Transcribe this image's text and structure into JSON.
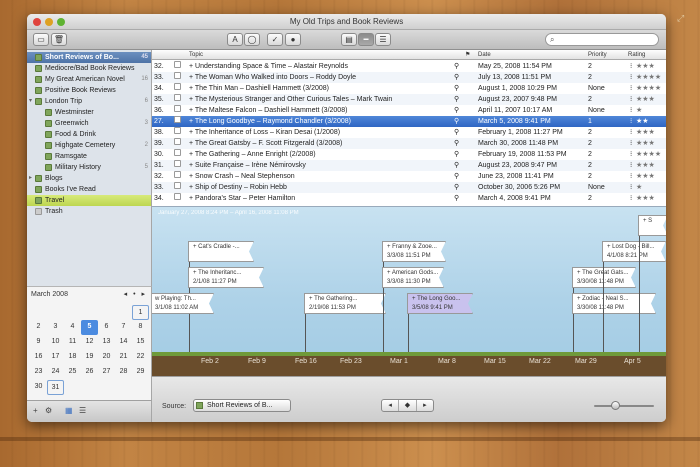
{
  "window": {
    "title": "My Old Trips and Book Reviews"
  },
  "toolbar": {
    "buttons": [
      {
        "name": "new-document-button",
        "icon": "document-icon",
        "glyph": "▭"
      },
      {
        "name": "delete-button",
        "icon": "trash-icon",
        "glyph": "🗑"
      },
      {
        "name": "font-button",
        "icon": "font-icon",
        "glyph": "A"
      },
      {
        "name": "color-button",
        "icon": "color-wheel-icon",
        "glyph": "◯"
      },
      {
        "name": "checkmark-button",
        "icon": "checkmark-icon",
        "glyph": "✓"
      },
      {
        "name": "record-button",
        "icon": "record-icon",
        "glyph": "●"
      },
      {
        "name": "view-outline-button",
        "icon": "outline-view-icon",
        "glyph": "▤"
      },
      {
        "name": "view-timeline-button",
        "icon": "timeline-view-icon",
        "glyph": "━"
      },
      {
        "name": "view-list-button",
        "icon": "list-view-icon",
        "glyph": "☰"
      }
    ],
    "search": {
      "icon": "search-icon",
      "glyph": "⌕",
      "placeholder": ""
    }
  },
  "sidebar": {
    "items": [
      {
        "label": "Short Reviews of Bo...",
        "count": "45",
        "indent": 0,
        "state": "sel",
        "disclosure": ""
      },
      {
        "label": "Mediocre/Bad Book Reviews",
        "count": "",
        "indent": 0,
        "state": "",
        "disclosure": ""
      },
      {
        "label": "My Great American Novel",
        "count": "16",
        "indent": 0,
        "state": "",
        "disclosure": ""
      },
      {
        "label": "Positive Book Reviews",
        "count": "",
        "indent": 0,
        "state": "",
        "disclosure": ""
      },
      {
        "label": "London Trip",
        "count": "6",
        "indent": 0,
        "state": "",
        "disclosure": "▾"
      },
      {
        "label": "Westminster",
        "count": "",
        "indent": 1,
        "state": "",
        "disclosure": ""
      },
      {
        "label": "Greenwich",
        "count": "3",
        "indent": 1,
        "state": "",
        "disclosure": ""
      },
      {
        "label": "Food & Drink",
        "count": "",
        "indent": 1,
        "state": "",
        "disclosure": ""
      },
      {
        "label": "Highgate Cemetery",
        "count": "2",
        "indent": 1,
        "state": "",
        "disclosure": ""
      },
      {
        "label": "Ramsgate",
        "count": "",
        "indent": 1,
        "state": "",
        "disclosure": ""
      },
      {
        "label": "Military History",
        "count": "5",
        "indent": 1,
        "state": "",
        "disclosure": ""
      },
      {
        "label": "Blogs",
        "count": "",
        "indent": 0,
        "state": "",
        "disclosure": "▸"
      },
      {
        "label": "Books I've Read",
        "count": "",
        "indent": 0,
        "state": "",
        "disclosure": ""
      },
      {
        "label": "Travel",
        "count": "",
        "indent": 0,
        "state": "hl",
        "disclosure": ""
      },
      {
        "label": "Trash",
        "count": "",
        "indent": 0,
        "state": "",
        "disclosure": ""
      }
    ]
  },
  "calendar": {
    "month": "March 2008",
    "nav": "◂ • ▸",
    "weeks": [
      [
        {
          "d": "",
          "c": ""
        },
        {
          "d": "",
          "c": ""
        },
        {
          "d": "",
          "c": ""
        },
        {
          "d": "",
          "c": ""
        },
        {
          "d": "",
          "c": ""
        },
        {
          "d": "",
          "c": ""
        },
        {
          "d": "1",
          "c": "o"
        }
      ],
      [
        {
          "d": "2",
          "c": ""
        },
        {
          "d": "3",
          "c": ""
        },
        {
          "d": "4",
          "c": ""
        },
        {
          "d": "5",
          "c": "t"
        },
        {
          "d": "6",
          "c": ""
        },
        {
          "d": "7",
          "c": ""
        },
        {
          "d": "8",
          "c": ""
        }
      ],
      [
        {
          "d": "9",
          "c": ""
        },
        {
          "d": "10",
          "c": ""
        },
        {
          "d": "11",
          "c": ""
        },
        {
          "d": "12",
          "c": ""
        },
        {
          "d": "13",
          "c": ""
        },
        {
          "d": "14",
          "c": ""
        },
        {
          "d": "15",
          "c": ""
        }
      ],
      [
        {
          "d": "16",
          "c": ""
        },
        {
          "d": "17",
          "c": ""
        },
        {
          "d": "18",
          "c": ""
        },
        {
          "d": "19",
          "c": ""
        },
        {
          "d": "20",
          "c": ""
        },
        {
          "d": "21",
          "c": ""
        },
        {
          "d": "22",
          "c": ""
        }
      ],
      [
        {
          "d": "23",
          "c": ""
        },
        {
          "d": "24",
          "c": ""
        },
        {
          "d": "25",
          "c": ""
        },
        {
          "d": "26",
          "c": ""
        },
        {
          "d": "27",
          "c": ""
        },
        {
          "d": "28",
          "c": ""
        },
        {
          "d": "29",
          "c": ""
        }
      ],
      [
        {
          "d": "30",
          "c": ""
        },
        {
          "d": "31",
          "c": "o"
        },
        {
          "d": "",
          "c": ""
        },
        {
          "d": "",
          "c": ""
        },
        {
          "d": "",
          "c": ""
        },
        {
          "d": "",
          "c": ""
        },
        {
          "d": "",
          "c": ""
        }
      ]
    ]
  },
  "sidebar_footer": {
    "add": "+",
    "gear": "⚙",
    "view": "▦",
    "list": "☰"
  },
  "table": {
    "columns": {
      "topic": "Topic",
      "date": "Date",
      "priority": "Priority",
      "rating": "Rating"
    },
    "rows": [
      {
        "num": "32.",
        "topic": "+ Understanding Space & Time – Alastair Reynolds",
        "date": "May 25, 2008 11:54 PM",
        "priority": "2",
        "rating": "★★★"
      },
      {
        "num": "33.",
        "topic": "+ The Woman Who Walked into Doors – Roddy Doyle",
        "date": "July 13, 2008 11:51 PM",
        "priority": "2",
        "rating": "★★★★"
      },
      {
        "num": "34.",
        "topic": "+ The Thin Man – Dashiell Hammett (3/2008)",
        "date": "August 1, 2008 10:29 PM",
        "priority": "None",
        "rating": "★★★★"
      },
      {
        "num": "35.",
        "topic": "+ The Mysterious Stranger and Other Curious Tales – Mark Twain",
        "date": "August 23, 2007 9:48 PM",
        "priority": "2",
        "rating": "★★★"
      },
      {
        "num": "36.",
        "topic": "+ The Maltese Falcon – Dashiell Hammett (3/2008)",
        "date": "April 11, 2007 10:17 AM",
        "priority": "None",
        "rating": "★"
      },
      {
        "num": "27.",
        "topic": "+ The Long Goodbye – Raymond Chandler (3/2008)",
        "date": "March 5, 2008 9:41 PM",
        "priority": "1",
        "rating": "★★"
      },
      {
        "num": "38.",
        "topic": "+ The Inheritance of Loss – Kiran Desai (1/2008)",
        "date": "February 1, 2008 11:27 PM",
        "priority": "2",
        "rating": "★★★"
      },
      {
        "num": "39.",
        "topic": "+ The Great Gatsby – F. Scott Fitzgerald (3/2008)",
        "date": "March 30, 2008 11:48 PM",
        "priority": "2",
        "rating": "★★★"
      },
      {
        "num": "30.",
        "topic": "+ The Gathering – Anne Enright (2/2008)",
        "date": "February 19, 2008 11:53 PM",
        "priority": "2",
        "rating": "★★★★"
      },
      {
        "num": "31.",
        "topic": "+ Suite Française – Irène Némirovsky",
        "date": "August 23, 2008 9:47 PM",
        "priority": "2",
        "rating": "★★★"
      },
      {
        "num": "32.",
        "topic": "+ Snow Crash – Neal Stephenson",
        "date": "June 23, 2008 11:41 PM",
        "priority": "2",
        "rating": "★★★"
      },
      {
        "num": "33.",
        "topic": "+ Ship of Destiny – Robin Hebb",
        "date": "October 30, 2006 5:26 PM",
        "priority": "None",
        "rating": "★"
      },
      {
        "num": "34.",
        "topic": "+ Pandora's Star – Peter Hamilton",
        "date": "March 4, 2008 9:41 PM",
        "priority": "2",
        "rating": "★★★"
      }
    ],
    "selected_index": 5
  },
  "timeline": {
    "range": "January 27, 2008 8:24 PM – April 16, 2008 11:08 PM",
    "ticks": [
      "Feb 2",
      "Feb 9",
      "Feb 16",
      "Feb 23",
      "Mar 1",
      "Mar 8",
      "Mar 15",
      "Mar 22",
      "Mar 29",
      "Apr 5"
    ],
    "flags": [
      {
        "line1": "+ Cat's Cradle -...",
        "line2": "",
        "sel": false
      },
      {
        "line1": "+ The Inheritanc...",
        "line2": "2/1/08 11:27 PM",
        "sel": false
      },
      {
        "line1": "w Playing: Th...",
        "line2": "3/1/08 11:02 AM",
        "sel": false
      },
      {
        "line1": "+ The Gathering...",
        "line2": "2/19/08 11:53 PM",
        "sel": false
      },
      {
        "line1": "+ Franny & Zooe...",
        "line2": "3/3/08 11:51 PM",
        "sel": false
      },
      {
        "line1": "+ American Gods...",
        "line2": "3/3/08 11:30 PM",
        "sel": false
      },
      {
        "line1": "+ The Long Goo...",
        "line2": "3/5/08 9:41 PM",
        "sel": true
      },
      {
        "line1": "+ The Great Gats...",
        "line2": "3/30/08 11:48 PM",
        "sel": false
      },
      {
        "line1": "+ Zodiac - Neal S...",
        "line2": "3/30/08 11:48 PM",
        "sel": false
      },
      {
        "line1": "+ Lost Dog - Bill...",
        "line2": "4/1/08 8:21 PM",
        "sel": false
      },
      {
        "line1": "+ S",
        "line2": "",
        "sel": false
      }
    ]
  },
  "footer": {
    "source_label": "Source:",
    "source_value": "Short Reviews of B...",
    "nav": [
      "◂",
      "◆",
      "▸"
    ]
  },
  "colors": {
    "selection": "#2f66c3",
    "accent_green": "#bdd650",
    "timeline_sky": "#aed2e8"
  }
}
